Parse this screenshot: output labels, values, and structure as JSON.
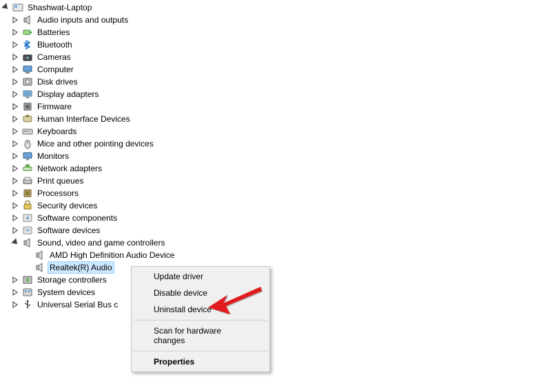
{
  "tree": {
    "root": "Shashwat-Laptop",
    "items": [
      {
        "label": "Audio inputs and outputs",
        "icon": "speaker"
      },
      {
        "label": "Batteries",
        "icon": "battery"
      },
      {
        "label": "Bluetooth",
        "icon": "bluetooth"
      },
      {
        "label": "Cameras",
        "icon": "camera"
      },
      {
        "label": "Computer",
        "icon": "computer"
      },
      {
        "label": "Disk drives",
        "icon": "disk"
      },
      {
        "label": "Display adapters",
        "icon": "display"
      },
      {
        "label": "Firmware",
        "icon": "chip"
      },
      {
        "label": "Human Interface Devices",
        "icon": "hid"
      },
      {
        "label": "Keyboards",
        "icon": "keyboard"
      },
      {
        "label": "Mice and other pointing devices",
        "icon": "mouse"
      },
      {
        "label": "Monitors",
        "icon": "monitor"
      },
      {
        "label": "Network adapters",
        "icon": "network"
      },
      {
        "label": "Print queues",
        "icon": "printer"
      },
      {
        "label": "Processors",
        "icon": "cpu"
      },
      {
        "label": "Security devices",
        "icon": "security"
      },
      {
        "label": "Software components",
        "icon": "swcomp"
      },
      {
        "label": "Software devices",
        "icon": "swdev"
      },
      {
        "label": "Sound, video and game controllers",
        "icon": "speaker",
        "expanded": true,
        "children": [
          {
            "label": "AMD High Definition Audio Device",
            "icon": "speaker"
          },
          {
            "label": "Realtek(R) Audio",
            "icon": "speaker",
            "selected": true
          }
        ]
      },
      {
        "label": "Storage controllers",
        "icon": "storage"
      },
      {
        "label": "System devices",
        "icon": "system"
      },
      {
        "label": "Universal Serial Bus c",
        "icon": "usb",
        "truncated": true
      }
    ]
  },
  "contextMenu": {
    "items": [
      {
        "label": "Update driver"
      },
      {
        "label": "Disable device"
      },
      {
        "label": "Uninstall device"
      },
      {
        "sep": true
      },
      {
        "label": "Scan for hardware changes"
      },
      {
        "sep": true
      },
      {
        "label": "Properties",
        "bold": true
      }
    ]
  }
}
